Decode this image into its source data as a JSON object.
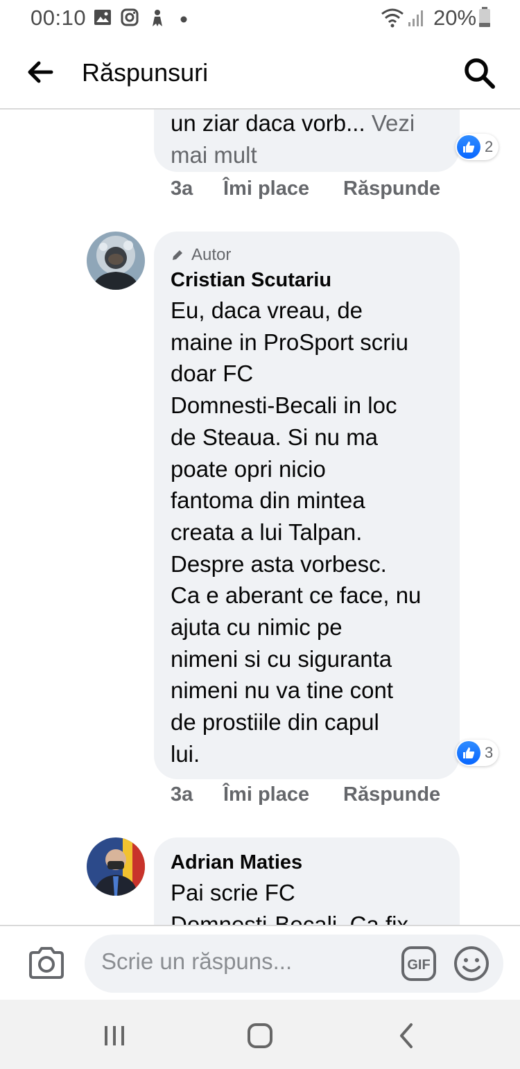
{
  "status_bar": {
    "time": "00:10",
    "battery": "20%",
    "icons": [
      "gallery-icon",
      "instagram-icon",
      "app-notification-icon",
      "dot-icon",
      "wifi-icon",
      "signal-icon",
      "battery-icon"
    ]
  },
  "header": {
    "title": "Răspunsuri",
    "back_icon": "arrow-left-icon",
    "search_icon": "search-icon"
  },
  "comments": [
    {
      "text_lines": [
        "un ziar daca vorb..."
      ],
      "see_more": "Vezi mai mult",
      "reaction_count": "2",
      "time": "3a",
      "like_label": "Îmi place",
      "reply_label": "Răspunde"
    },
    {
      "badge": "Autor",
      "name": "Cristian Scutariu",
      "text_lines": [
        "Eu, daca vreau, de",
        "maine in ProSport scriu",
        "doar FC",
        "Domnesti-Becali in loc",
        "de Steaua. Si nu ma",
        "poate opri nicio",
        "fantoma din mintea",
        "creata a lui Talpan.",
        "Despre asta vorbesc.",
        "Ca e aberant ce face, nu",
        "ajuta cu nimic pe",
        "nimeni si cu siguranta",
        "nimeni nu va tine cont",
        "de prostiile din capul",
        "lui."
      ],
      "reaction_count": "3",
      "time": "3a",
      "like_label": "Îmi place",
      "reply_label": "Răspunde"
    },
    {
      "name": "Adrian Maties",
      "text_lines": [
        "Pai scrie FC",
        "Domnesti-Becali. Ca fix"
      ]
    }
  ],
  "composer": {
    "placeholder": "Scrie un răspuns...",
    "gif_label": "GIF",
    "camera_icon": "camera-icon",
    "emoji_icon": "emoji-icon"
  },
  "nav_bar": {
    "icons": [
      "recent-apps-icon",
      "home-icon",
      "back-icon"
    ]
  },
  "colors": {
    "bubble": "#f0f2f5",
    "secondary_text": "#65676b",
    "like_blue": "#0866ff"
  }
}
